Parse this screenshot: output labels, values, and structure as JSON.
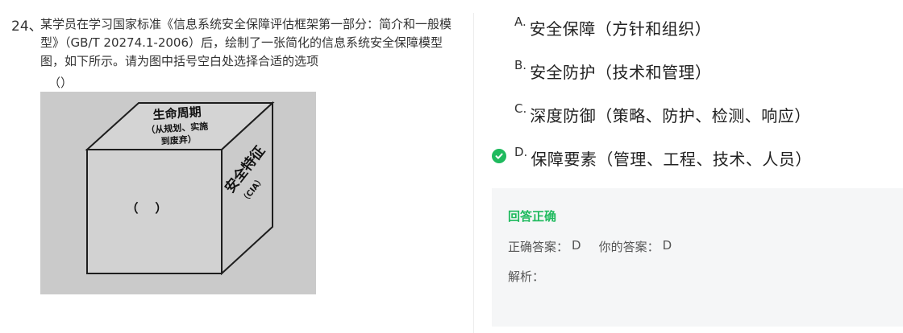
{
  "question": {
    "number": "24、",
    "text": "某学员在学习国家标准《信息系统安全保障评估框架第一部分：简介和一般模型》（GB/T 20274.1-2006）后，绘制了一张简化的信息系统安全保障模型图，如下所示。请为图中括号空白处选择合适的选项",
    "blank": "（）"
  },
  "figure": {
    "top_label_1": "生命周期",
    "top_label_2": "（从规划、实施",
    "top_label_3": "到废弃）",
    "side_label_1": "安全特征",
    "side_label_2": "（CIA）",
    "front_blank": "（    ）"
  },
  "options": [
    {
      "letter": "A.",
      "text": "安全保障（方针和组织）",
      "selected": false
    },
    {
      "letter": "B.",
      "text": "安全防护（技术和管理）",
      "selected": false
    },
    {
      "letter": "C.",
      "text": "深度防御（策略、防护、检测、响应）",
      "selected": false
    },
    {
      "letter": "D.",
      "text": "保障要素（管理、工程、技术、人员）",
      "selected": true
    }
  ],
  "answer": {
    "status": "回答正确",
    "correct_label": "正确答案：",
    "correct_value": "D",
    "yours_label": "你的答案：",
    "yours_value": "D",
    "explain_label": "解析："
  },
  "colors": {
    "correct": "#1fba5e",
    "answer_bg": "#f5f6f7"
  },
  "icons": {
    "selected_marker": "check-circle-icon"
  }
}
